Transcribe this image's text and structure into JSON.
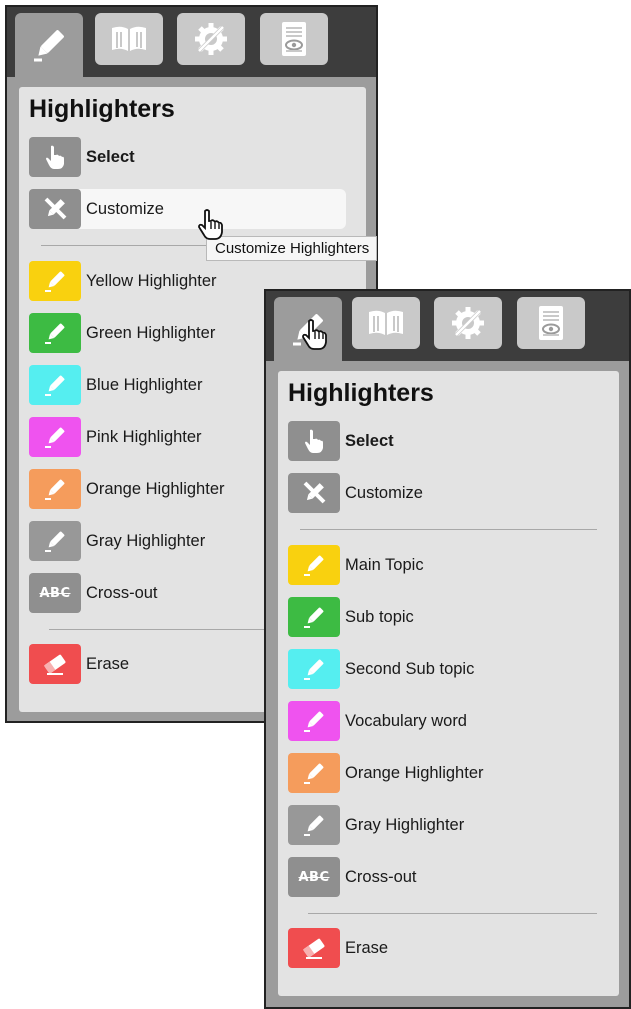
{
  "panel_a": {
    "tabs": [
      {
        "name": "highlighter-icon"
      },
      {
        "name": "book-icon"
      },
      {
        "name": "tools-icon"
      },
      {
        "name": "document-eye-icon"
      }
    ],
    "title": "Highlighters",
    "select_label": "Select",
    "customize_label": "Customize",
    "tooltip": "Customize Highlighters",
    "highlighters": [
      {
        "label": "Yellow Highlighter",
        "color": "#f9d10f"
      },
      {
        "label": "Green Highlighter",
        "color": "#3dbb43"
      },
      {
        "label": "Blue Highlighter",
        "color": "#55eef0"
      },
      {
        "label": "Pink Highlighter",
        "color": "#ef53ef"
      },
      {
        "label": "Orange Highlighter",
        "color": "#f59c5c"
      },
      {
        "label": "Gray Highlighter",
        "color": "#989898"
      }
    ],
    "crossout_label": "Cross-out",
    "crossout_icon_text": "ABC",
    "erase_label": "Erase"
  },
  "panel_b": {
    "title": "Highlighters",
    "select_label": "Select",
    "customize_label": "Customize",
    "highlighters": [
      {
        "label": "Main Topic",
        "color": "#f9d10f"
      },
      {
        "label": "Sub topic",
        "color": "#3dbb43"
      },
      {
        "label": "Second Sub topic",
        "color": "#55eef0"
      },
      {
        "label": "Vocabulary word",
        "color": "#ef53ef"
      },
      {
        "label": "Orange Highlighter",
        "color": "#f59c5c"
      },
      {
        "label": "Gray Highlighter",
        "color": "#989898"
      }
    ],
    "crossout_label": "Cross-out",
    "crossout_icon_text": "ABC",
    "erase_label": "Erase"
  },
  "colors": {
    "tool_gray": "#8f8f8f",
    "erase_red": "#f04d4f"
  }
}
